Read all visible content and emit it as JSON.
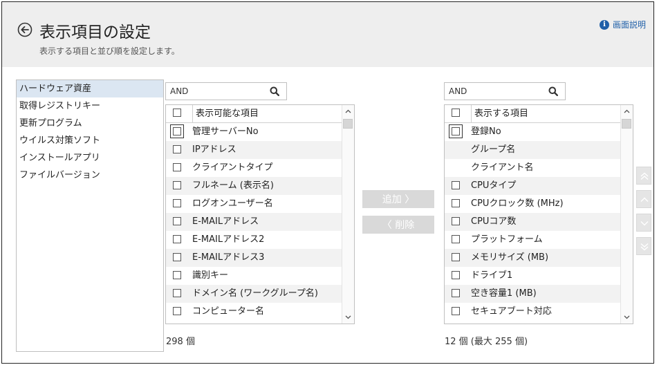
{
  "header": {
    "title": "表示項目の設定",
    "subtitle": "表示する項目と並び順を設定します。",
    "help_label": "画面説明",
    "help_icon": "i"
  },
  "categories": [
    {
      "label": "ハードウェア資産",
      "active": true
    },
    {
      "label": "取得レジストリキー",
      "active": false
    },
    {
      "label": "更新プログラム",
      "active": false
    },
    {
      "label": "ウイルス対策ソフト",
      "active": false
    },
    {
      "label": "インストールアプリ",
      "active": false
    },
    {
      "label": "ファイルバージョン",
      "active": false
    }
  ],
  "available": {
    "search_value": "AND",
    "header": "表示可能な項目",
    "items": [
      "管理サーバーNo",
      "IPアドレス",
      "クライアントタイプ",
      "フルネーム (表示名)",
      "ログオンユーザー名",
      "E-MAILアドレス",
      "E-MAILアドレス2",
      "E-MAILアドレス3",
      "識別キー",
      "ドメイン名 (ワークグループ名)",
      "コンピューター名"
    ],
    "count": "298 個"
  },
  "actions": {
    "add_label": "追加 〉",
    "remove_label": "〈 削除"
  },
  "displayed": {
    "search_value": "AND",
    "header": "表示する項目",
    "items": [
      {
        "label": "登録No",
        "checkbox": true
      },
      {
        "label": "グループ名",
        "checkbox": false
      },
      {
        "label": "クライアント名",
        "checkbox": false
      },
      {
        "label": "CPUタイプ",
        "checkbox": true
      },
      {
        "label": "CPUクロック数 (MHz)",
        "checkbox": true
      },
      {
        "label": "CPUコア数",
        "checkbox": true
      },
      {
        "label": "プラットフォーム",
        "checkbox": true
      },
      {
        "label": "メモリサイズ (MB)",
        "checkbox": true
      },
      {
        "label": "ドライブ1",
        "checkbox": true
      },
      {
        "label": "空き容量1 (MB)",
        "checkbox": true
      },
      {
        "label": "セキュアブート対応",
        "checkbox": true
      }
    ],
    "count": "12 個 (最大 255 個)"
  },
  "colors": {
    "accent": "#1f5fa8",
    "header_bg": "#eeeeee",
    "selected_bg": "#dbe6f2",
    "disabled_button": "#d9d9d9"
  }
}
